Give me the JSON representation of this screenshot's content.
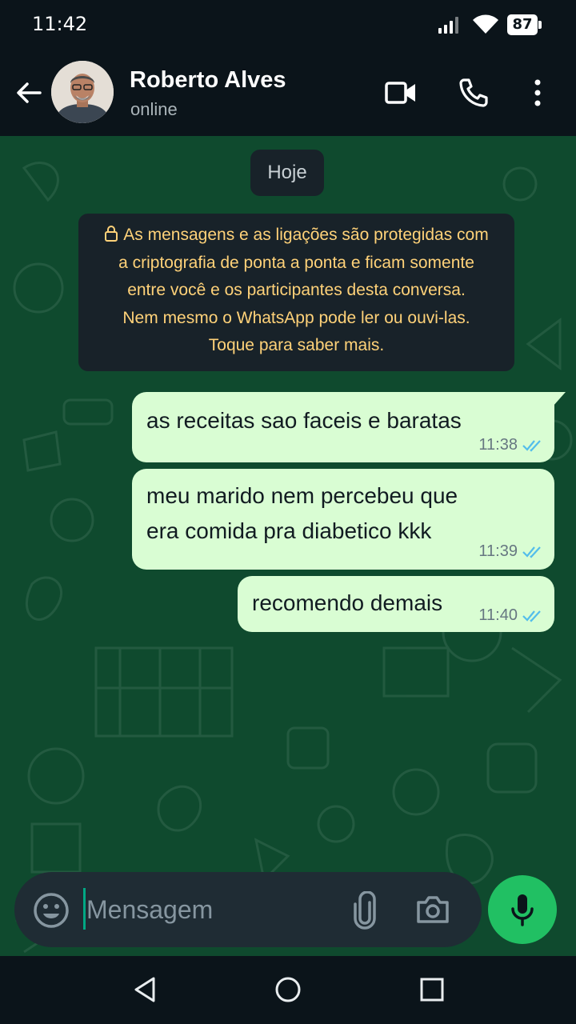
{
  "status_bar": {
    "time": "11:42",
    "battery": "87"
  },
  "header": {
    "contact_name": "Roberto Alves",
    "contact_status": "online"
  },
  "chat": {
    "date_chip": "Hoje",
    "e2e_notice": {
      "lines": [
        "As mensagens e as ligações são protegidas com",
        "a criptografia de ponta a ponta e ficam somente",
        "entre você e os participantes desta conversa.",
        "Nem mesmo o WhatsApp pode ler ou ouvi-las.",
        "Toque para saber mais."
      ]
    },
    "messages": [
      {
        "lines": [
          "as receitas sao faceis e baratas"
        ],
        "time": "11:38",
        "status": "read"
      },
      {
        "lines": [
          "meu marido nem percebeu que",
          "era comida pra diabetico kkk"
        ],
        "time": "11:39",
        "status": "read"
      },
      {
        "lines": [
          "recomendo demais"
        ],
        "time": "11:40",
        "status": "read"
      }
    ]
  },
  "input": {
    "placeholder": "Mensagem"
  },
  "icons": {
    "back": "arrow-left-icon",
    "video": "video-camera-icon",
    "call": "phone-icon",
    "menu": "more-vertical-icon",
    "emoji": "smiley-icon",
    "attach": "paperclip-icon",
    "camera": "camera-icon",
    "mic": "microphone-icon",
    "lock": "lock-icon",
    "ticks": "double-check-icon"
  },
  "colors": {
    "outgoing_bubble": "#d9fdd3",
    "chat_background": "#0f4a2e",
    "read_ticks": "#53bdeb",
    "mic_button": "#21c063",
    "notice_text": "#ffd279"
  }
}
